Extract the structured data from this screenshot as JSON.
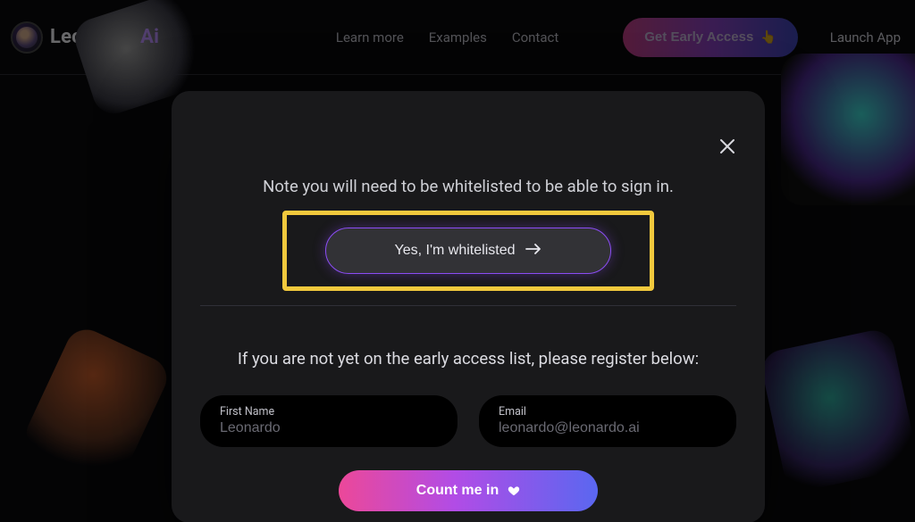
{
  "brand": {
    "name1": "Leonardo",
    "dot": ".",
    "name2": "Ai"
  },
  "nav": {
    "learn": "Learn more",
    "examples": "Examples",
    "contact": "Contact"
  },
  "header": {
    "early_access": "Get Early Access",
    "launch": "Launch App"
  },
  "modal": {
    "notice": "Note you will need to be whitelisted to be able to sign in.",
    "whitelisted_btn": "Yes, I'm whitelisted",
    "register_msg": "If you are not yet on the early access list, please register below:",
    "first_name_label": "First Name",
    "first_name_placeholder": "Leonardo",
    "email_label": "Email",
    "email_placeholder": "leonardo@leonardo.ai",
    "submit": "Count me in"
  }
}
